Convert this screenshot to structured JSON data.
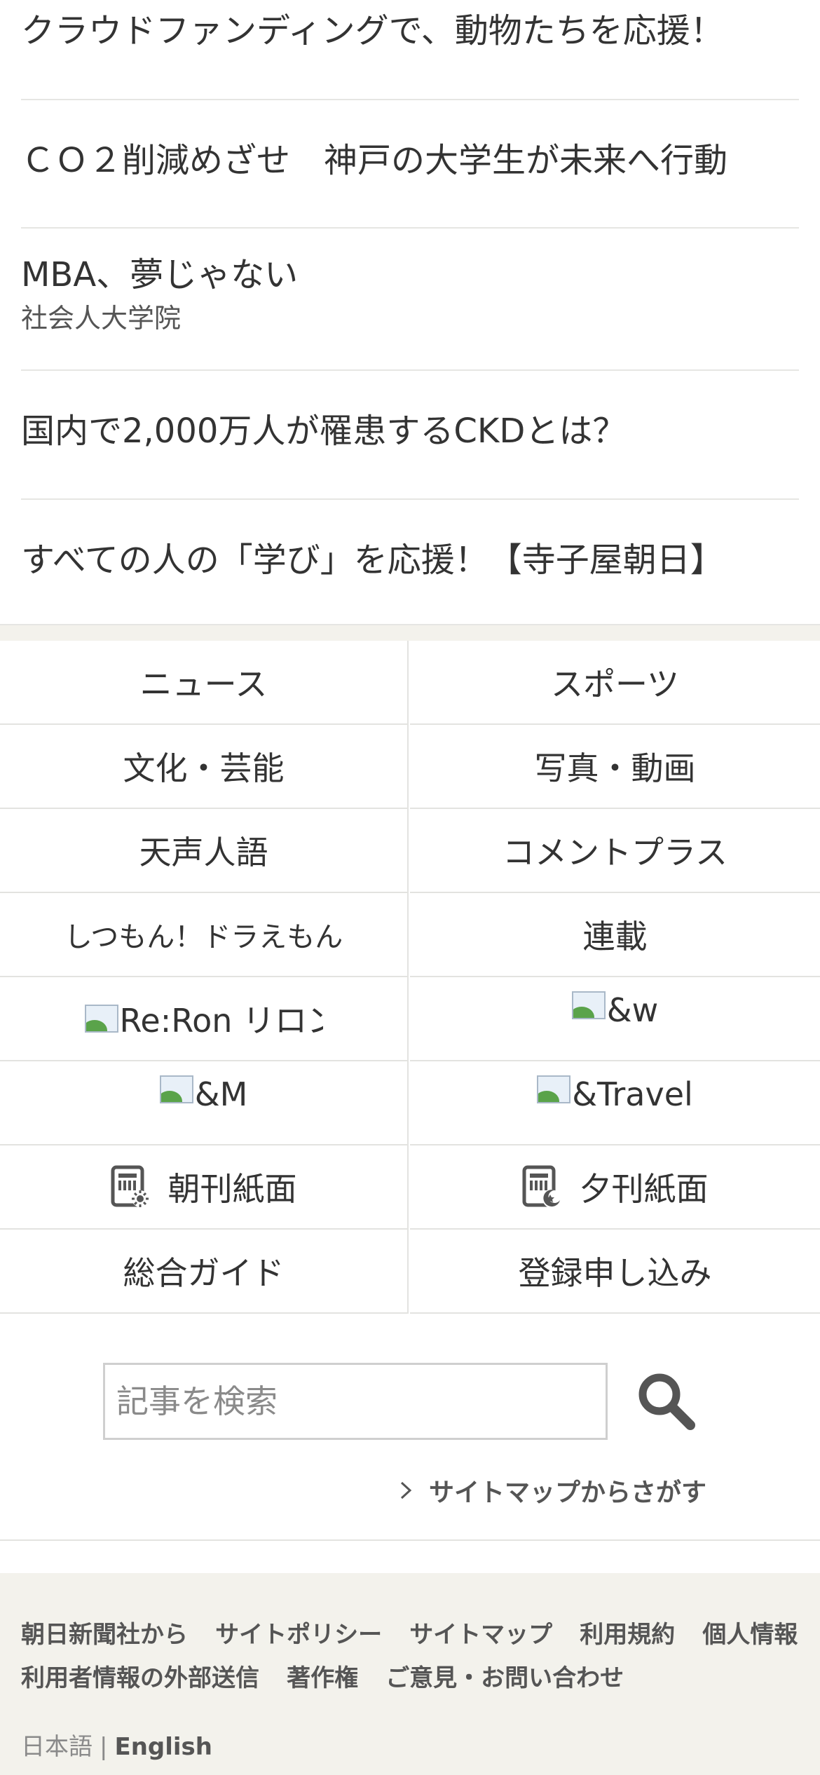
{
  "promos": [
    {
      "title": "クラウドファンディングで、動物たちを応援！"
    },
    {
      "title": "ＣＯ２削減めざせ　神戸の大学生が未来へ行動"
    },
    {
      "title": "MBA、夢じゃない",
      "subtitle": "社会人大学院"
    },
    {
      "title": "国内で2,000万人が罹患するCKDとは？"
    },
    {
      "title": "すべての人の「学び」を応援！【寺子屋朝日】"
    }
  ],
  "nav": {
    "news": "ニュース",
    "sports": "スポーツ",
    "culture": "文化・芸能",
    "photo_video": "写真・動画",
    "tensei": "天声人語",
    "comment_plus": "コメントプラス",
    "doraemon": "しつもん！ドラえもん",
    "series": "連載",
    "reron": "Re:Ron リロン",
    "and_w": "&w",
    "and_m": "&M",
    "and_travel": "&Travel",
    "morning_paper": "朝刊紙面",
    "evening_paper": "夕刊紙面",
    "guide": "総合ガイド",
    "register": "登録申し込み"
  },
  "search": {
    "placeholder": "記事を検索",
    "icon": "search-icon",
    "sitemap_link": "サイトマップからさがす"
  },
  "footer": {
    "row1": [
      "朝日新聞社から",
      "サイトポリシー",
      "サイトマップ",
      "利用規約",
      "個人情報"
    ],
    "row2": [
      "利用者情報の外部送信",
      "著作権",
      "ご意見・お問い合わせ"
    ],
    "lang_ja": "日本語",
    "lang_sep": "|",
    "lang_en": "English"
  },
  "colors": {
    "text": "#333333",
    "footer_bg": "#f3f2ec",
    "divider": "#e3e3e0"
  }
}
